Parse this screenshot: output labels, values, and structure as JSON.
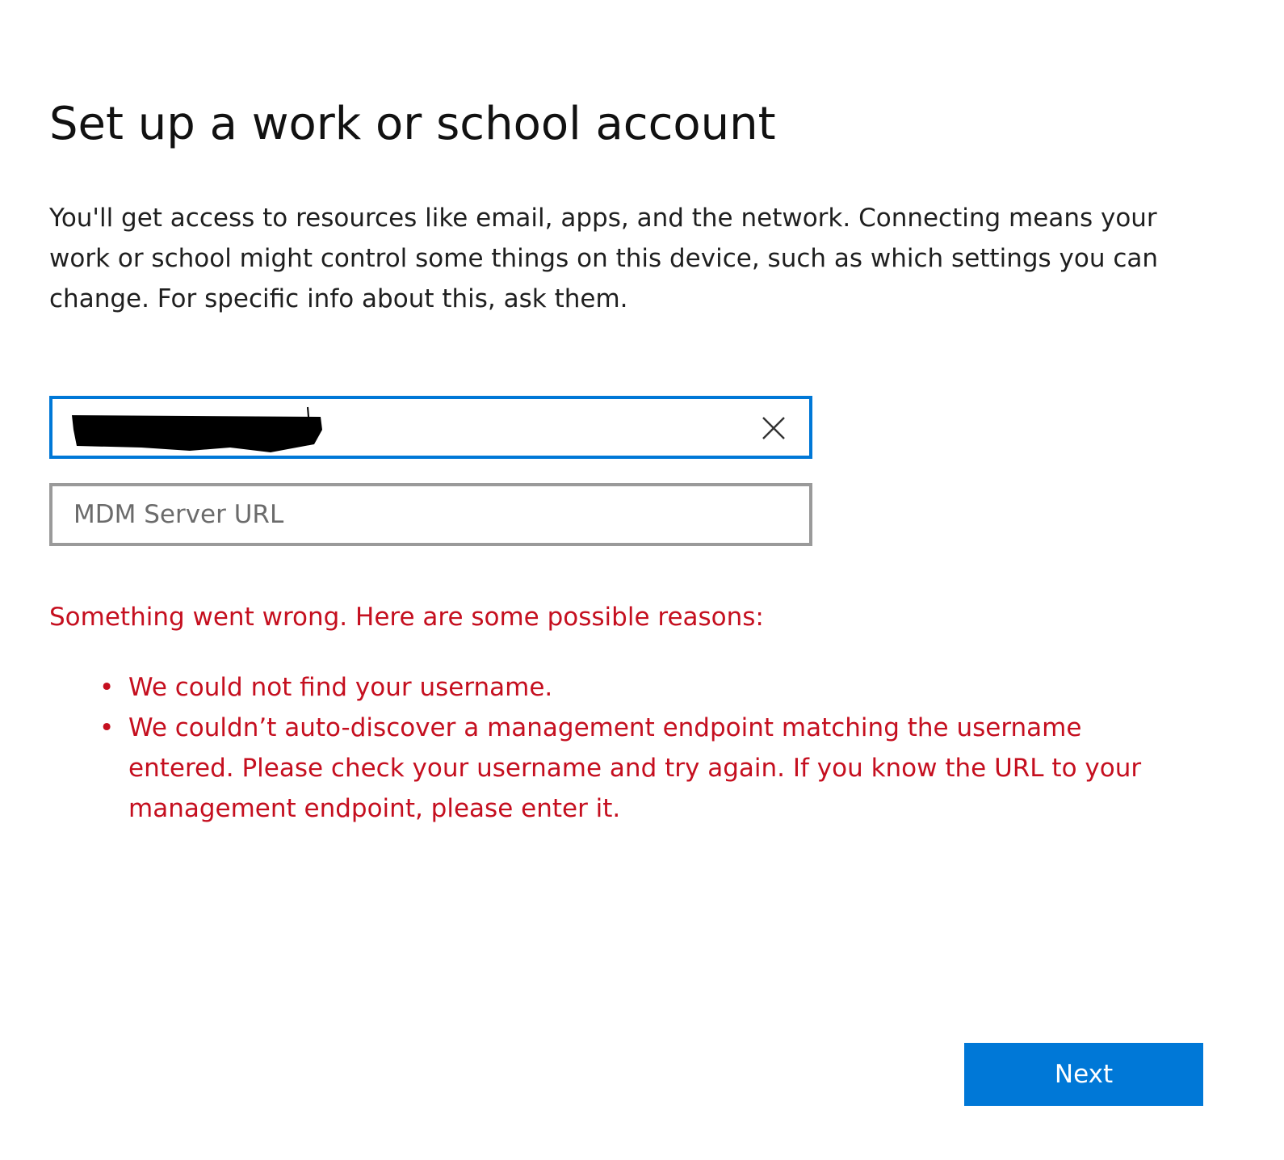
{
  "page": {
    "title": "Set up a work or school account",
    "description": "You'll get access to resources like email, apps, and the network. Connecting means your work or school might control some things on this device, such as which settings you can change. For specific info about this, ask them."
  },
  "form": {
    "username": {
      "value": "",
      "clear_icon": "close-icon"
    },
    "mdm_server": {
      "placeholder": "MDM Server URL",
      "value": ""
    }
  },
  "error": {
    "heading": "Something went wrong. Here are some possible reasons:",
    "bullet": "•",
    "reasons": [
      "We could not find your username.",
      "We couldn’t auto-discover a management endpoint matching the username entered. Please check your username and try again. If you know the URL to your management endpoint, please enter it."
    ]
  },
  "actions": {
    "next_label": "Next"
  },
  "colors": {
    "accent": "#0078d7",
    "error": "#c50f1f",
    "border_inactive": "#9a9a9a"
  }
}
